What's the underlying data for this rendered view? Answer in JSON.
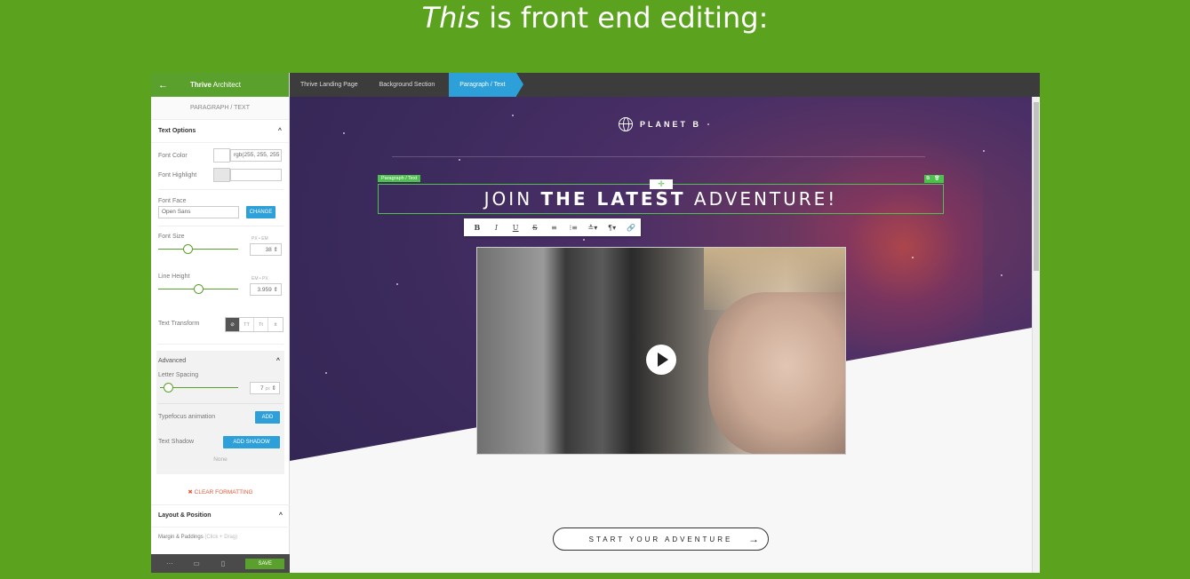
{
  "headline": {
    "em": "This",
    "rest": " is front end editing:"
  },
  "sidebar": {
    "back_icon": "←",
    "brand_bold": "Thrive",
    "brand_rest": " Architect",
    "subtitle": "PARAGRAPH / TEXT",
    "text_options": {
      "title": "Text Options",
      "chevron": "^",
      "font_color_label": "Font Color",
      "font_color_value": "rgb(255, 255, 255",
      "font_highlight_label": "Font Highlight",
      "font_face_label": "Font Face",
      "font_face_value": "Open Sans",
      "change_label": "CHANGE",
      "font_size_label": "Font Size",
      "font_size_units": "PX • EM",
      "font_size_value": "38",
      "font_size_level": 0.37,
      "line_height_label": "Line Height",
      "line_height_units": "EM • PX",
      "line_height_value": "3.959",
      "line_height_level": 0.5,
      "text_transform_label": "Text Transform",
      "transform_options": [
        "⊘",
        "TT",
        "Tt",
        "tt"
      ]
    },
    "advanced": {
      "title": "Advanced",
      "chevron": "^",
      "letter_spacing_label": "Letter Spacing",
      "letter_spacing_value": "7",
      "letter_spacing_unit": "px",
      "letter_spacing_level": 0.1,
      "typefocus_label": "Typefocus animation",
      "add_label": "ADD",
      "text_shadow_label": "Text Shadow",
      "add_shadow_label": "ADD SHADOW",
      "shadow_value": "None"
    },
    "clear_formatting": "✖ CLEAR FORMATTING",
    "layout": {
      "title": "Layout & Position",
      "chevron": "^",
      "margin_label": "Margin & Paddings",
      "margin_hint": " (Click + Drag)"
    },
    "footer": {
      "more": "···",
      "desktop": "▭",
      "mobile": "▯",
      "save_label": "SAVE"
    },
    "collapse_icon": "‹"
  },
  "breadcrumbs": [
    "Thrive Landing Page",
    "Background Section",
    "Paragraph / Text"
  ],
  "canvas": {
    "logo_text": "PLANET B",
    "selection_tag": "Paragraph / Text",
    "selection_plus": "✛",
    "selection_icons": "⧉ 🗑",
    "heading_pre": "JOIN ",
    "heading_bold": "THE LATEST",
    "heading_post": " ADVENTURE!",
    "toolbar": [
      "B",
      "I",
      "U",
      "S",
      "≡",
      "⁝≡",
      "≛▾",
      "¶▾",
      "🔗"
    ],
    "cta_label": "START YOUR ADVENTURE",
    "cta_arrow": "→"
  },
  "colors": {
    "page_bg": "#5ba31f",
    "accent_green": "#5aa02c",
    "accent_blue": "#2d9fd9"
  }
}
